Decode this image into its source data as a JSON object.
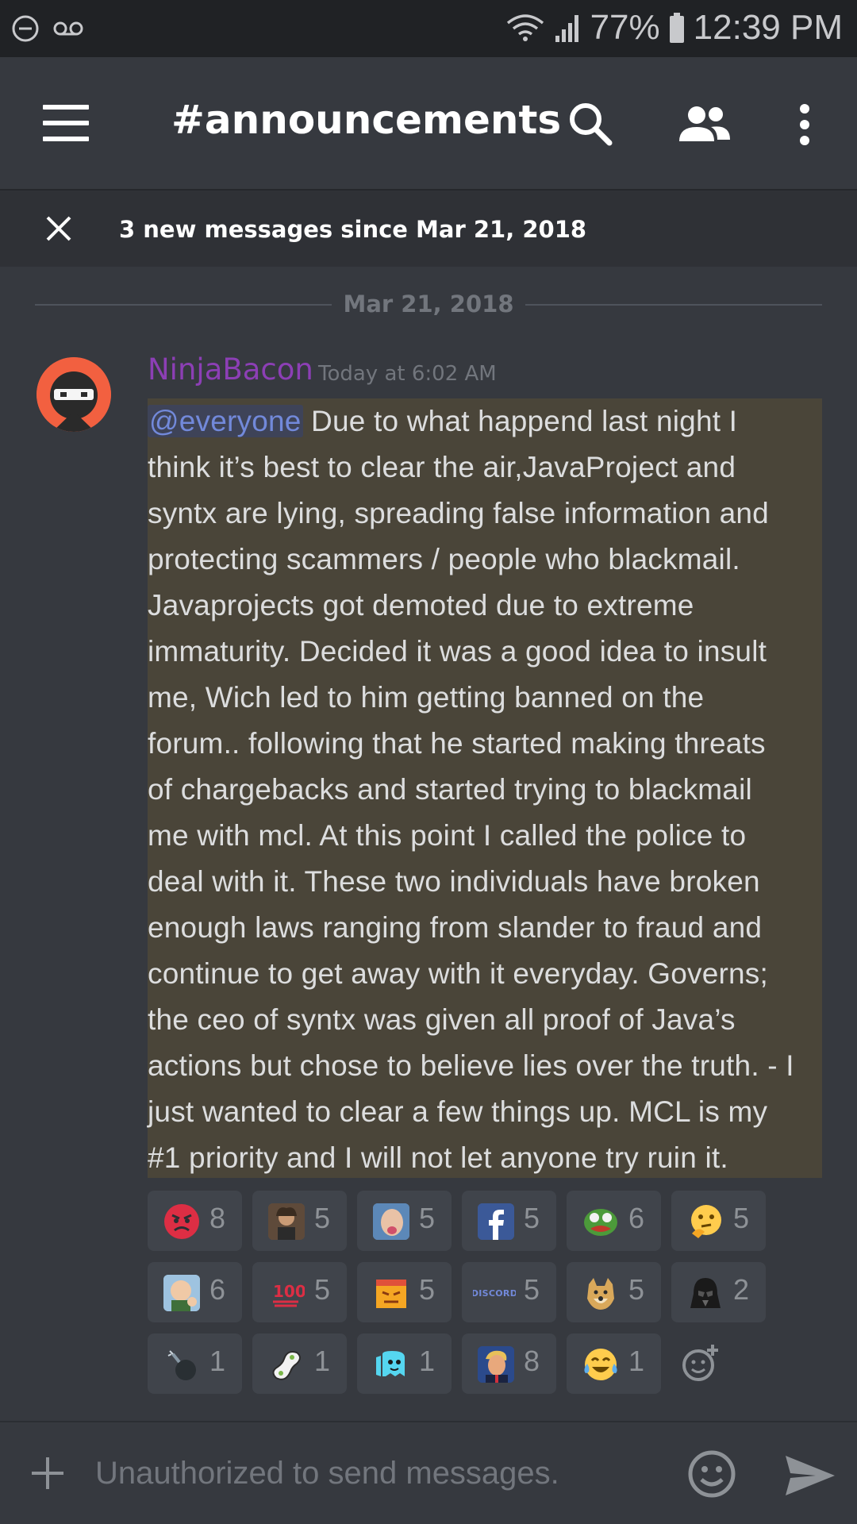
{
  "status_bar": {
    "battery": "77%",
    "time": "12:39 PM",
    "icons": [
      "dnd-icon",
      "voicemail-icon",
      "wifi-icon",
      "signal-icon",
      "battery-icon"
    ]
  },
  "header": {
    "channel": "#announcements",
    "icons": [
      "menu-icon",
      "search-icon",
      "members-icon",
      "more-icon"
    ]
  },
  "new_messages_bar": {
    "text": "3 new messages since Mar 21, 2018"
  },
  "date_divider": "Mar 21, 2018",
  "message": {
    "author": "NinjaBacon",
    "author_color": "#8c3fb5",
    "timestamp": "Today at 6:02 AM",
    "mention": "@everyone",
    "lines": [
      " Due to what happend last night I",
      "think it’s best to clear the air,JavaProject and",
      "syntx are lying, spreading false information and",
      "protecting scammers / people who blackmail.",
      "Javaprojects got demoted due to extreme",
      "immaturity. Decided it was a good idea to insult",
      "me, Wich led to him getting banned on the",
      "forum.. following that he started making threats",
      "of chargebacks and started trying to blackmail",
      "me with mcl. At this point I called the police to",
      "deal with it. These two individuals have broken",
      "enough laws ranging from slander to fraud and",
      "continue to get away with it everyday. Governs;",
      "the ceo of syntx was given all proof of Java’s",
      "actions but chose to believe lies over the truth. - I",
      "just wanted to clear a few things up. MCL is my",
      "#1 priority and I will not let anyone try ruin it."
    ]
  },
  "reactions": [
    {
      "icon": "angry-face-icon",
      "count": "8"
    },
    {
      "icon": "aliens-guy-icon",
      "count": "5"
    },
    {
      "icon": "tongue-face-icon",
      "count": "5"
    },
    {
      "icon": "facebook-icon",
      "count": "5"
    },
    {
      "icon": "pepe-icon",
      "count": "6"
    },
    {
      "icon": "thinking-face-icon",
      "count": "5"
    },
    {
      "icon": "success-kid-icon",
      "count": "6"
    },
    {
      "icon": "hundred-icon",
      "count": "5"
    },
    {
      "icon": "angry-block-icon",
      "count": "5"
    },
    {
      "icon": "discord-logo-icon",
      "count": "5",
      "label": "DISCORD"
    },
    {
      "icon": "doge-icon",
      "count": "5"
    },
    {
      "icon": "darth-vader-icon",
      "count": "2"
    },
    {
      "icon": "bomb-icon",
      "count": "1"
    },
    {
      "icon": "peanut-icon",
      "count": "1"
    },
    {
      "icon": "ghost-icon",
      "count": "1"
    },
    {
      "icon": "trump-icon",
      "count": "8"
    },
    {
      "icon": "tears-of-joy-icon",
      "count": "1"
    }
  ],
  "input": {
    "placeholder": "Unauthorized to send messages.",
    "icons": [
      "plus-icon",
      "emoji-icon",
      "send-icon"
    ]
  }
}
